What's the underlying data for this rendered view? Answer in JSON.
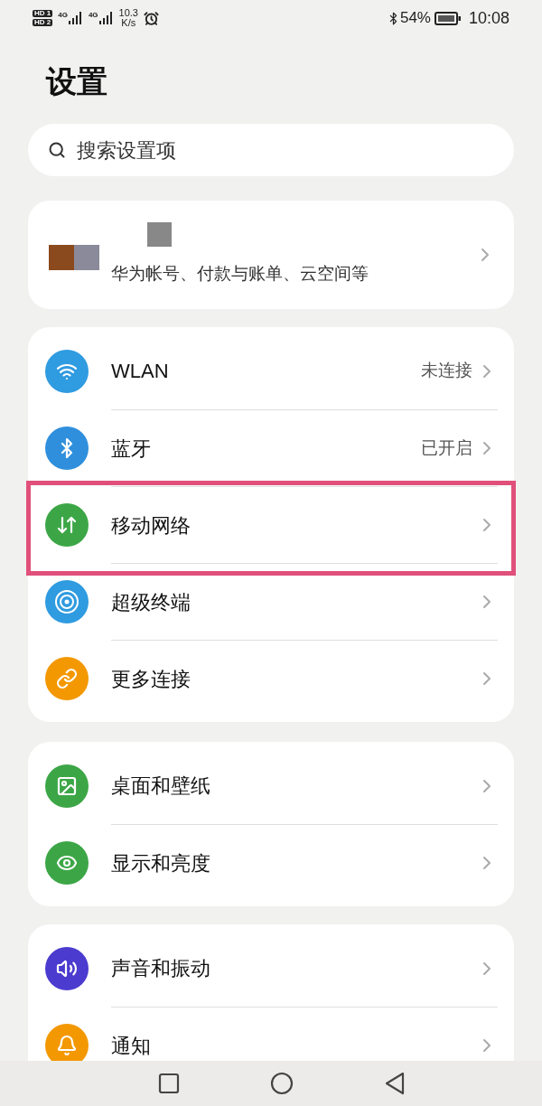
{
  "status_bar": {
    "sims": [
      "HD 1",
      "HD 2"
    ],
    "networks": [
      "4G",
      "4G"
    ],
    "speed": "10.3",
    "speed_unit": "K/s",
    "battery": "54%",
    "time": "10:08"
  },
  "title": "设置",
  "search": {
    "placeholder": "搜索设置项"
  },
  "account": {
    "subtitle": "华为帐号、付款与账单、云空间等"
  },
  "groups": [
    {
      "items": [
        {
          "label": "WLAN",
          "value": "未连接",
          "highlighted": false
        },
        {
          "label": "蓝牙",
          "value": "已开启",
          "highlighted": false
        },
        {
          "label": "移动网络",
          "highlighted": true
        },
        {
          "label": "超级终端",
          "highlighted": false
        },
        {
          "label": "更多连接",
          "highlighted": false
        }
      ]
    },
    {
      "items": [
        {
          "label": "桌面和壁纸",
          "highlighted": false
        },
        {
          "label": "显示和亮度",
          "highlighted": false
        }
      ]
    },
    {
      "items": [
        {
          "label": "声音和振动",
          "highlighted": false
        },
        {
          "label": "通知",
          "highlighted": false
        }
      ]
    }
  ]
}
